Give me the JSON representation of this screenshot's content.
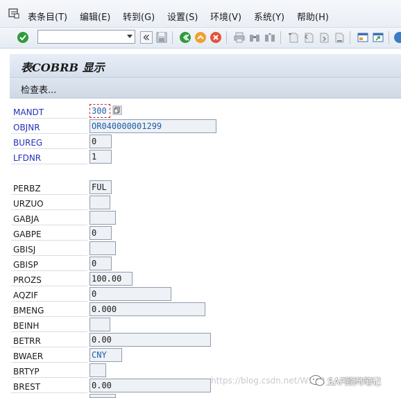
{
  "menubar": {
    "items": [
      {
        "label": "表条目(T)"
      },
      {
        "label": "编辑(E)"
      },
      {
        "label": "转到(G)"
      },
      {
        "label": "设置(S)"
      },
      {
        "label": "环境(V)"
      },
      {
        "label": "系统(Y)"
      },
      {
        "label": "帮助(H)"
      }
    ]
  },
  "toolbar": {
    "command_value": "",
    "icons": [
      "enter-icon",
      "command-dropdown-icon",
      "collapse-icon",
      "save-icon",
      "back-icon",
      "exit-icon",
      "cancel-icon",
      "print-icon",
      "find-icon",
      "find-next-icon",
      "first-page-icon",
      "previous-page-icon",
      "next-page-icon",
      "last-page-icon",
      "create-session-icon",
      "shortcut-icon",
      "help-icon"
    ],
    "colors": {
      "enter": "#2e9c3a",
      "back": "#2e9c3a",
      "exit": "#f0a030",
      "cancel": "#e2553a"
    }
  },
  "title": "表COBRB 显示",
  "app_toolbar": {
    "check_table_label": "检查表..."
  },
  "fields": [
    {
      "name": "MANDT",
      "value": "300",
      "key": true
    },
    {
      "name": "OBJNR",
      "value": "OR040000001299",
      "key": true
    },
    {
      "name": "BUREG",
      "value": "0",
      "key": true
    },
    {
      "name": "LFDNR",
      "value": "1",
      "key": true
    },
    {
      "name": "PERBZ",
      "value": "FUL",
      "key": false
    },
    {
      "name": "URZUO",
      "value": "",
      "key": false
    },
    {
      "name": "GABJA",
      "value": "",
      "key": false
    },
    {
      "name": "GABPE",
      "value": "0",
      "key": false
    },
    {
      "name": "GBISJ",
      "value": "",
      "key": false
    },
    {
      "name": "GBISP",
      "value": "0",
      "key": false
    },
    {
      "name": "PROZS",
      "value": "100.00",
      "key": false
    },
    {
      "name": "AQZIF",
      "value": "0",
      "key": false
    },
    {
      "name": "BMENG",
      "value": "0.000",
      "key": false
    },
    {
      "name": "BEINH",
      "value": "",
      "key": false
    },
    {
      "name": "BETRR",
      "value": "0.00",
      "key": false
    },
    {
      "name": "BWAER",
      "value": "CNY",
      "key": false
    },
    {
      "name": "BRTYP",
      "value": "",
      "key": false
    },
    {
      "name": "BREST",
      "value": "0.00",
      "key": false
    }
  ],
  "watermark": {
    "url": "https://blog.csdn.net/WSUR_I_U591004",
    "text": "SAP顾问笔记"
  },
  "colors": {
    "key_label": "#2430b6",
    "value_blue": "#1c5fa8",
    "focus_border": "#d02020"
  }
}
